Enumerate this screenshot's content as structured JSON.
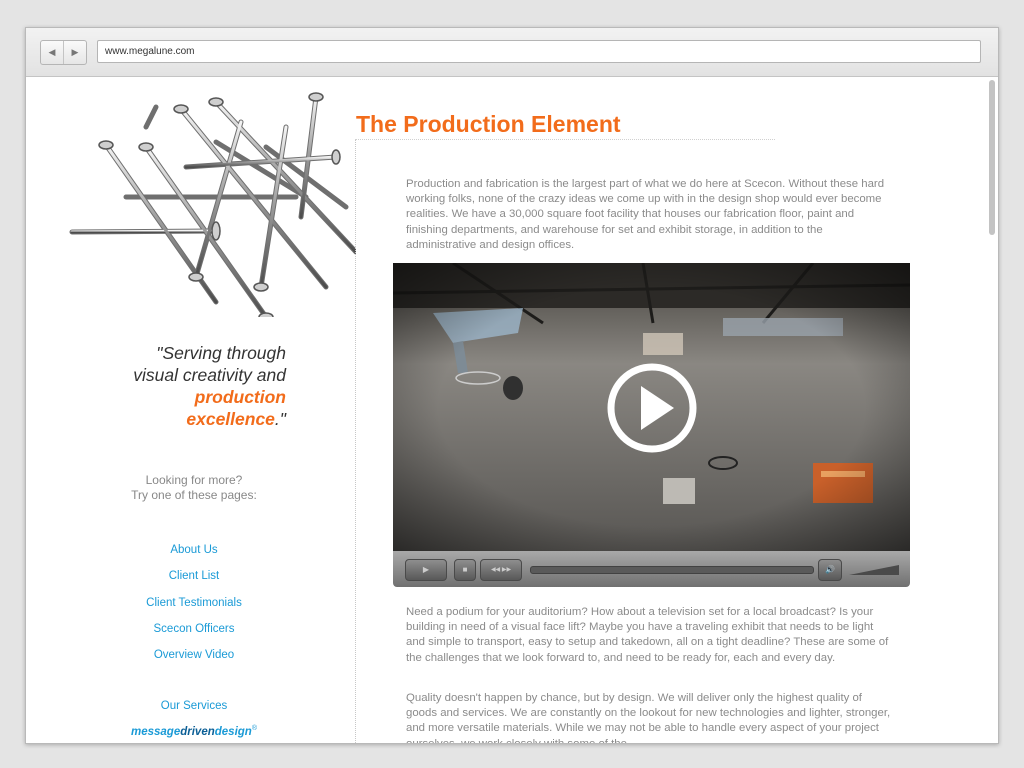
{
  "browser": {
    "back_glyph": "◀",
    "forward_glyph": "▶",
    "url": "www.megalune.com"
  },
  "page": {
    "title": "The Production Element",
    "intro": "Production and fabrication is the largest part of what we do here at Scecon. Without these hard working folks, none of the crazy ideas we come up with in the design shop would ever become realities. We have a 30,000 square foot facility that houses our fabrication floor, paint and finishing departments, and warehouse for set and exhibit storage, in addition to the administrative and design offices.",
    "body_1": "Need a podium for your auditorium? How about a television set for a local broadcast? Is your building in need of a visual face lift? Maybe you have a traveling exhibit that needs to be light and simple to transport, easy to setup and takedown, all on a tight deadline? These are some of the challenges that we look forward to, and need to be ready for, each and every day.",
    "body_2": "Quality doesn't happen by chance, but by design. We will deliver only the highest quality of goods and services. We are constantly on the lookout for new technologies and lighter, stronger, and more versatile materials. While we may not be able to handle every aspect of your project ourselves, we work closely with some of the"
  },
  "sidebar": {
    "quote_open": "\"Serving through visual creativity and ",
    "quote_highlight": "production excellence",
    "quote_close": ".\"",
    "more_line1": "Looking for more?",
    "more_line2": "Try one of these pages:",
    "links": [
      "About Us",
      "Client List",
      "Client Testimonials",
      "Scecon Officers",
      "Overview Video"
    ],
    "services": "Our Services",
    "brand_part1": "message",
    "brand_part2": "driven",
    "brand_part3": "design",
    "brand_mark": "®"
  },
  "video": {
    "play_glyph": "▶",
    "stop_glyph": "■",
    "seek_glyph": "◀◀ ▶▶",
    "volume_glyph": "🔊"
  },
  "colors": {
    "accent_orange": "#f26c1b",
    "link_blue": "#1a9ad6"
  }
}
